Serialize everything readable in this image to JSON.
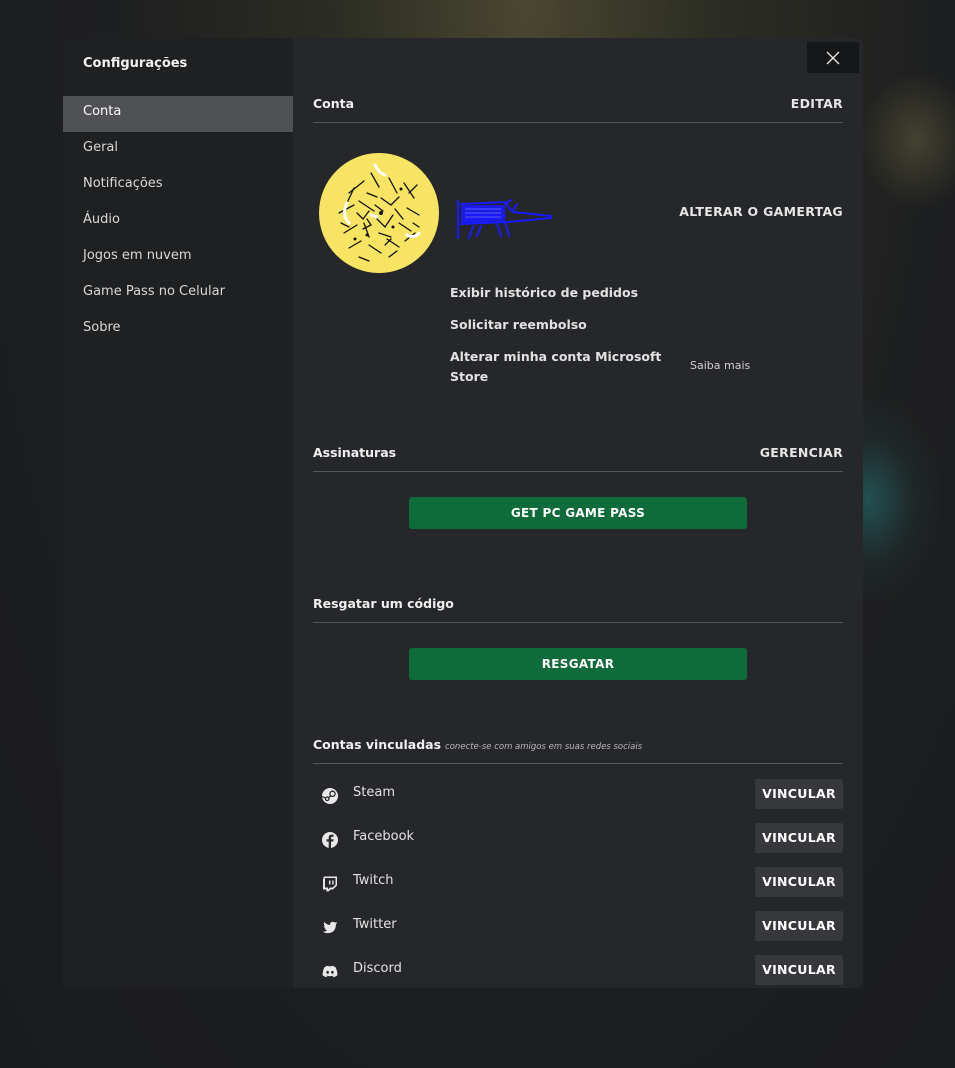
{
  "dialog": {
    "title": "Configurações",
    "close_icon": "close-icon"
  },
  "sidebar": {
    "items": [
      {
        "label": "Conta",
        "active": true
      },
      {
        "label": "Geral"
      },
      {
        "label": "Notificações"
      },
      {
        "label": "Áudio"
      },
      {
        "label": "Jogos em nuvem"
      },
      {
        "label": "Game Pass no Celular"
      },
      {
        "label": "Sobre"
      }
    ]
  },
  "account": {
    "title": "Conta",
    "edit_label": "EDITAR",
    "change_gamertag_label": "ALTERAR O GAMERTAG",
    "links": {
      "order_history": "Exibir histórico de pedidos",
      "refund": "Solicitar reembolso",
      "change_store_line1": "Alterar minha conta Microsoft",
      "change_store_line2": "Store",
      "learn_more": "Saiba mais"
    }
  },
  "subscriptions": {
    "title": "Assinaturas",
    "manage_label": "GERENCIAR",
    "cta_label": "GET PC GAME PASS"
  },
  "redeem": {
    "title": "Resgatar um código",
    "button_label": "RESGATAR"
  },
  "linked_accounts": {
    "title": "Contas vinculadas",
    "subtitle": "conecte-se com amigos em suas redes sociais",
    "items": [
      {
        "name": "Steam",
        "icon": "steam-icon",
        "action": "VINCULAR"
      },
      {
        "name": "Facebook",
        "icon": "facebook-icon",
        "action": "VINCULAR"
      },
      {
        "name": "Twitch",
        "icon": "twitch-icon",
        "action": "VINCULAR"
      },
      {
        "name": "Twitter",
        "icon": "twitter-icon",
        "action": "VINCULAR"
      },
      {
        "name": "Discord",
        "icon": "discord-icon",
        "action": "VINCULAR"
      }
    ]
  },
  "colors": {
    "accent_green": "#0e6b3a",
    "avatar_yellow": "#f7e463",
    "gamertag_scribble": "#1a1aff",
    "active_nav": "#505154"
  }
}
